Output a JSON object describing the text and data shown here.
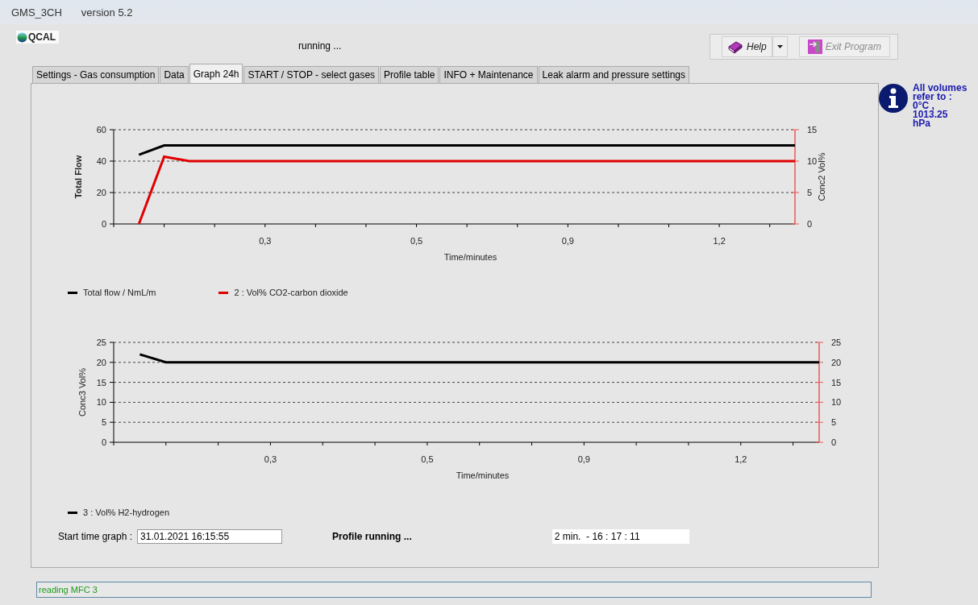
{
  "window": {
    "title": "GMS_3CH",
    "version": "version 5.2"
  },
  "logo": {
    "text": "QCAL"
  },
  "run_status": "running ...",
  "toolbar": {
    "buttons": [
      {
        "kind": "help",
        "label": "Help",
        "disabled": false
      },
      {
        "kind": "exit",
        "label": "Exit Program",
        "disabled": true
      }
    ]
  },
  "tabs": [
    {
      "label": "Settings - Gas consumption",
      "selected": false
    },
    {
      "label": "Data",
      "selected": false
    },
    {
      "label": "Graph 24h",
      "selected": true
    },
    {
      "label": "START / STOP  - select gases",
      "selected": false
    },
    {
      "label": "Profile table",
      "selected": false
    },
    {
      "label": "INFO + Maintenance",
      "selected": false
    },
    {
      "label": "Leak alarm and pressure settings",
      "selected": false
    }
  ],
  "info_note": [
    "All volumes",
    "refer to :",
    "0°C ,",
    "1013.25",
    "hPa"
  ],
  "charts": [
    {
      "chart_data": {
        "type": "line",
        "grid": true,
        "xlabel": "Time/minutes",
        "ylabel": "Total Flow",
        "y2label": "Conc2 Vol%",
        "ylim": [
          0,
          60
        ],
        "y2lim": [
          0,
          15
        ],
        "categories": [
          null,
          null,
          null,
          null,
          null,
          null,
          "0,3",
          null,
          null,
          null,
          null,
          null,
          "0,5",
          null,
          null,
          null,
          null,
          null,
          "0,9",
          null,
          null,
          null,
          null,
          null,
          "1,2",
          null,
          null,
          null
        ],
        "yticks": [
          0,
          20,
          40,
          60
        ],
        "y2ticks": [
          0,
          5,
          10,
          15
        ],
        "series": [
          {
            "name": "Total flow / NmL/m",
            "color": "#000000",
            "values": [
              null,
              44,
              50,
              50,
              50,
              50,
              50,
              50,
              50,
              50,
              50,
              50,
              50,
              50,
              50,
              50,
              50,
              50,
              50,
              50,
              50,
              50,
              50,
              50,
              50,
              50,
              50,
              50
            ]
          },
          {
            "name": "2 : Vol% CO2-carbon dioxide",
            "color": "#e00000",
            "axis": "y2",
            "values": [
              null,
              0,
              10.7,
              10,
              10,
              10,
              10,
              10,
              10,
              10,
              10,
              10,
              10,
              10,
              10,
              10,
              10,
              10,
              10,
              10,
              10,
              10,
              10,
              10,
              10,
              10,
              10,
              10
            ]
          }
        ]
      }
    },
    {
      "chart_data": {
        "type": "line",
        "grid": true,
        "xlabel": "Time/minutes",
        "ylabel": "Conc3 Vol%",
        "ylim": [
          0,
          25
        ],
        "y2lim": [
          0,
          25
        ],
        "categories": [
          null,
          null,
          null,
          null,
          null,
          null,
          "0,3",
          null,
          null,
          null,
          null,
          null,
          "0,5",
          null,
          null,
          null,
          null,
          null,
          "0,9",
          null,
          null,
          null,
          null,
          null,
          "1,2",
          null,
          null,
          null
        ],
        "yticks": [
          0,
          5,
          10,
          15,
          20,
          25
        ],
        "y2ticks": [
          0,
          5,
          10,
          15,
          20,
          25
        ],
        "series": [
          {
            "name": "3 : Vol% H2-hydrogen",
            "color": "#000000",
            "values": [
              null,
              22,
              20,
              20,
              20,
              20,
              20,
              20,
              20,
              20,
              20,
              20,
              20,
              20,
              20,
              20,
              20,
              20,
              20,
              20,
              20,
              20,
              20,
              20,
              20,
              20,
              20,
              20
            ]
          }
        ]
      }
    }
  ],
  "bottom": {
    "start_label": "Start time graph :",
    "start_value": "31.01.2021 16:15:55",
    "profile_status": "Profile running ...",
    "elapsed": "2 min.  - 16 : 17 : 11"
  },
  "status_bar": "reading MFC 3"
}
